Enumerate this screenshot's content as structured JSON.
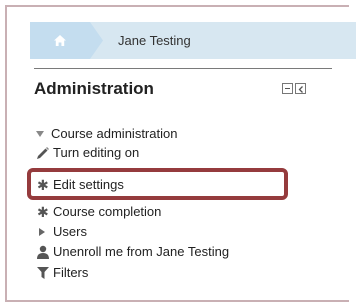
{
  "breadcrumb": {
    "home_icon": "home-icon",
    "current": "Jane Testing"
  },
  "block": {
    "title": "Administration",
    "controls": [
      {
        "icon": "collapse-icon"
      },
      {
        "icon": "dock-icon"
      }
    ]
  },
  "tree": {
    "items": [
      {
        "label": "Course administration",
        "icon": "expanded-arrow-icon"
      },
      {
        "label": "Turn editing on",
        "icon": "pencil-icon"
      },
      {
        "label": "Edit settings",
        "icon": "gear-icon",
        "highlighted": true
      },
      {
        "label": "Course completion",
        "icon": "gear-icon"
      },
      {
        "label": "Users",
        "icon": "collapsed-arrow-icon"
      },
      {
        "label": "Unenroll me from Jane Testing",
        "icon": "user-icon"
      },
      {
        "label": "Filters",
        "icon": "filter-icon"
      }
    ]
  },
  "colors": {
    "breadcrumb_bg": "#d7e7f1",
    "highlight_border": "#953b3d"
  }
}
